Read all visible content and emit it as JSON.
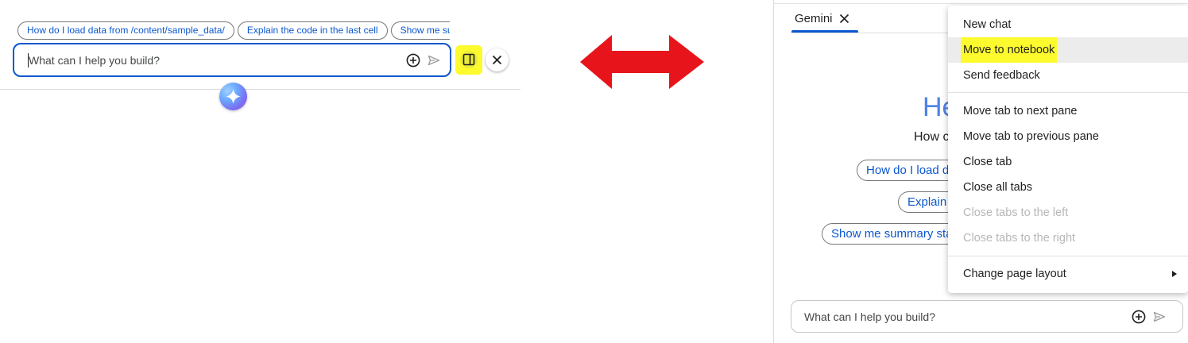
{
  "left_panel": {
    "suggestions": [
      "How do I load data from /content/sample_data/",
      "Explain the code in the last cell",
      "Show me summary statistics"
    ],
    "prompt_placeholder": "What can I help you build?"
  },
  "right_panel": {
    "tab_label": "Gemini",
    "greeting_partial": "He",
    "subtitle_partial": "How c",
    "suggestions": [
      "How do I load da",
      "Explain",
      "Show me summary sta"
    ],
    "prompt_placeholder": "What can I help you build?"
  },
  "context_menu": {
    "groups": [
      [
        "New chat",
        "Move to notebook",
        "Send feedback"
      ],
      [
        "Move tab to next pane",
        "Move tab to previous pane",
        "Close tab",
        "Close all tabs",
        "Close tabs to the left",
        "Close tabs to the right"
      ],
      [
        "Change page layout"
      ]
    ],
    "highlighted": "Move to notebook",
    "disabled": [
      "Close tabs to the left",
      "Close tabs to the right"
    ]
  },
  "colors": {
    "accent": "#0b57d0",
    "highlight": "#fdfa2e",
    "arrow": "#e8141c",
    "greeting": "#4f82e8"
  },
  "icons": {
    "add": "plus-circle-icon",
    "send": "send-icon",
    "panel": "side-panel-icon",
    "close": "close-icon",
    "gemini": "sparkle-icon",
    "arrow": "double-arrow-icon",
    "submenu": "submenu-triangle-icon"
  }
}
